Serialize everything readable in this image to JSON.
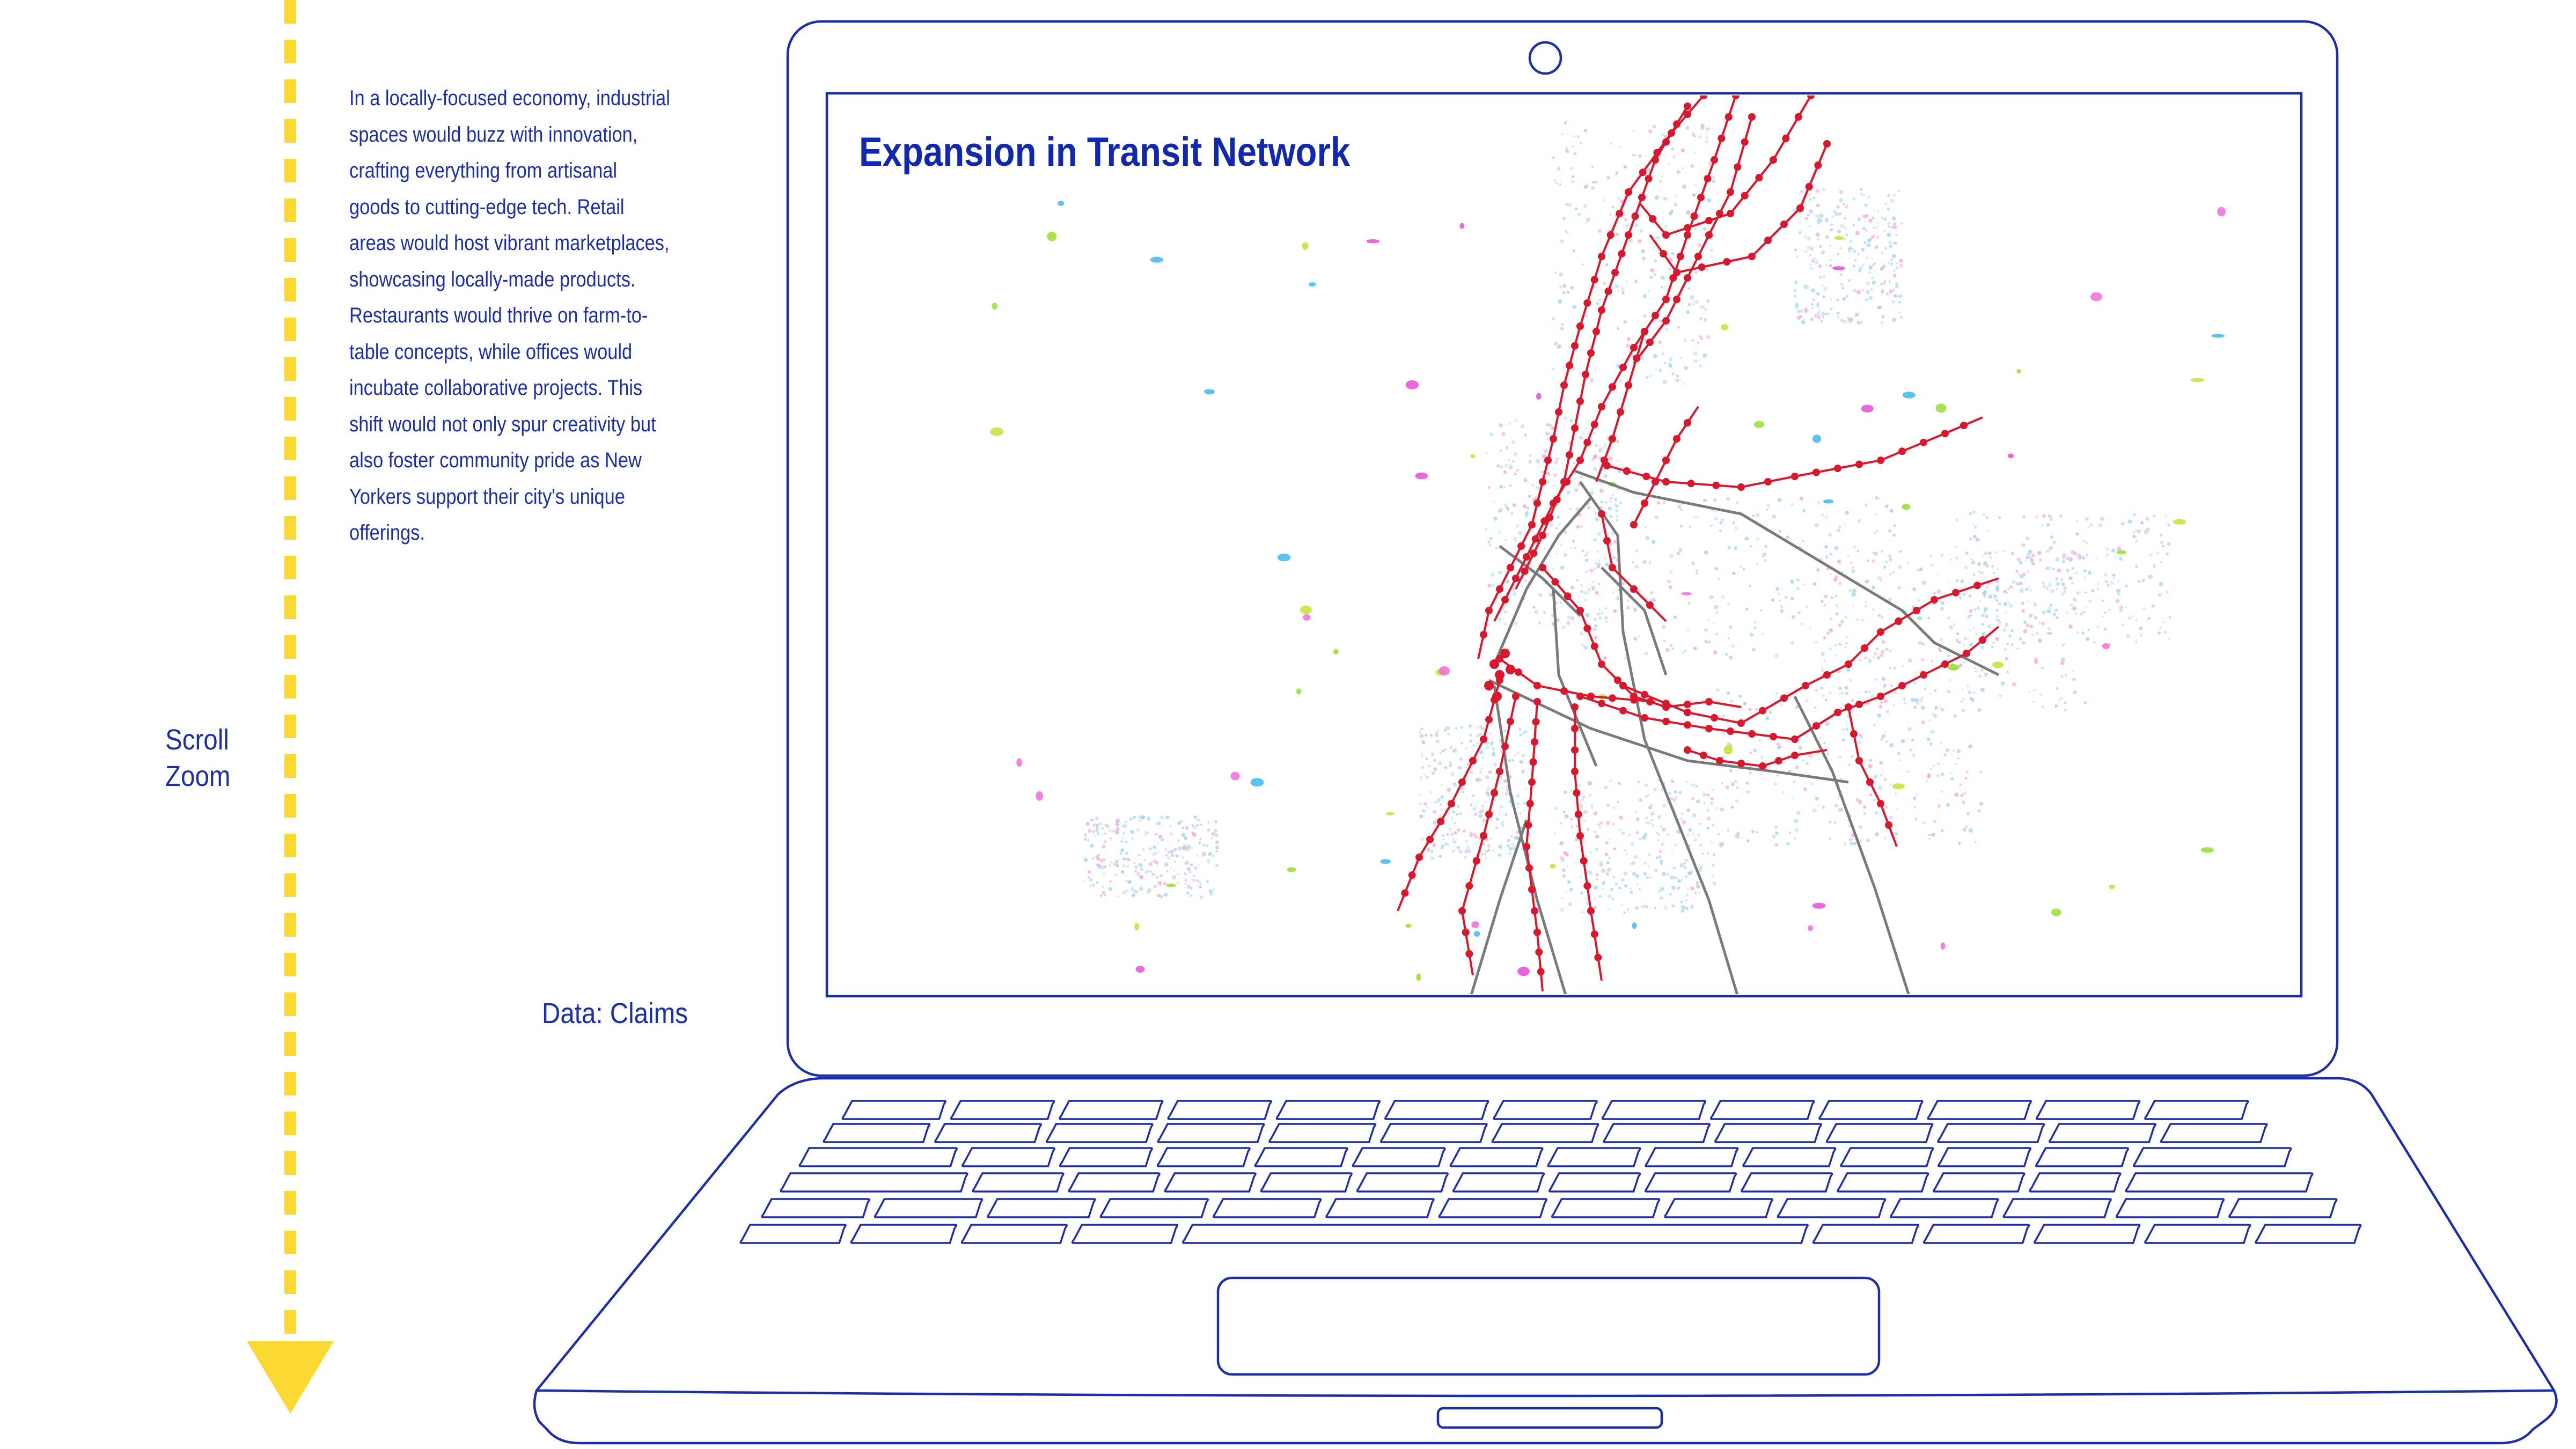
{
  "story": {
    "paragraph": "In a locally-focused economy, industrial spaces would buzz with innovation, crafting everything from artisanal goods to cutting-edge tech. Retail areas would host vibrant marketplaces, showcasing locally-made products. Restaurants would thrive on farm-to-table concepts, while offices would incubate collaborative projects. This shift would not only spur creativity but also foster community pride as New Yorkers support their city's unique offerings."
  },
  "scroll_hint": {
    "line1": "Scroll",
    "line2": "Zoom"
  },
  "data_source": "Data: Claims",
  "map": {
    "title": "Expansion in Transit Network"
  },
  "icons": {
    "scroll_arrow": "arrow-down-icon",
    "camera": "webcam-icon",
    "trackpad": "trackpad-icon"
  },
  "colors": {
    "ui_blue": "#1c2ea8",
    "title_blue": "#1028b0",
    "arrow_yellow": "#fcd832",
    "station_red": "#d9182d",
    "rail_grey": "#7a7a7a"
  }
}
